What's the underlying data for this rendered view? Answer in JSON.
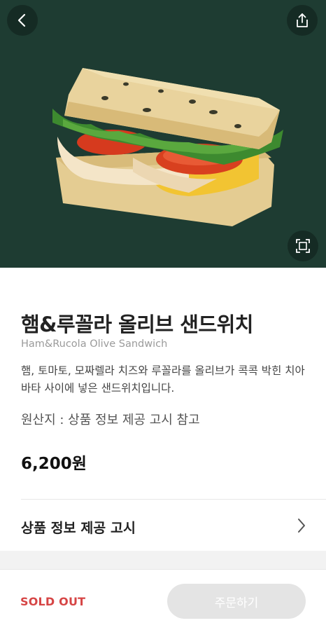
{
  "header": {
    "back_icon": "chevron-left-icon",
    "share_icon": "share-icon",
    "zoom_icon": "expand-icon"
  },
  "product": {
    "name_ko": "햄&루꼴라 올리브 샌드위치",
    "name_en": "Ham&Rucola Olive Sandwich",
    "description": "햄, 토마토, 모짜렐라 치즈와 루꼴라를 올리브가 콕콕 박힌 치아바타 사이에 넣은 샌드위치입니다.",
    "origin": "원산지 : 상품 정보 제공 고시 참고",
    "price": "6,200원"
  },
  "notice": {
    "label": "상품 정보 제공 고시"
  },
  "bottom": {
    "status": "SOLD OUT",
    "order_label": "주문하기"
  },
  "colors": {
    "hero_bg": "#1e3c32",
    "sold_out": "#d64545",
    "order_disabled": "#e4e4e4"
  }
}
